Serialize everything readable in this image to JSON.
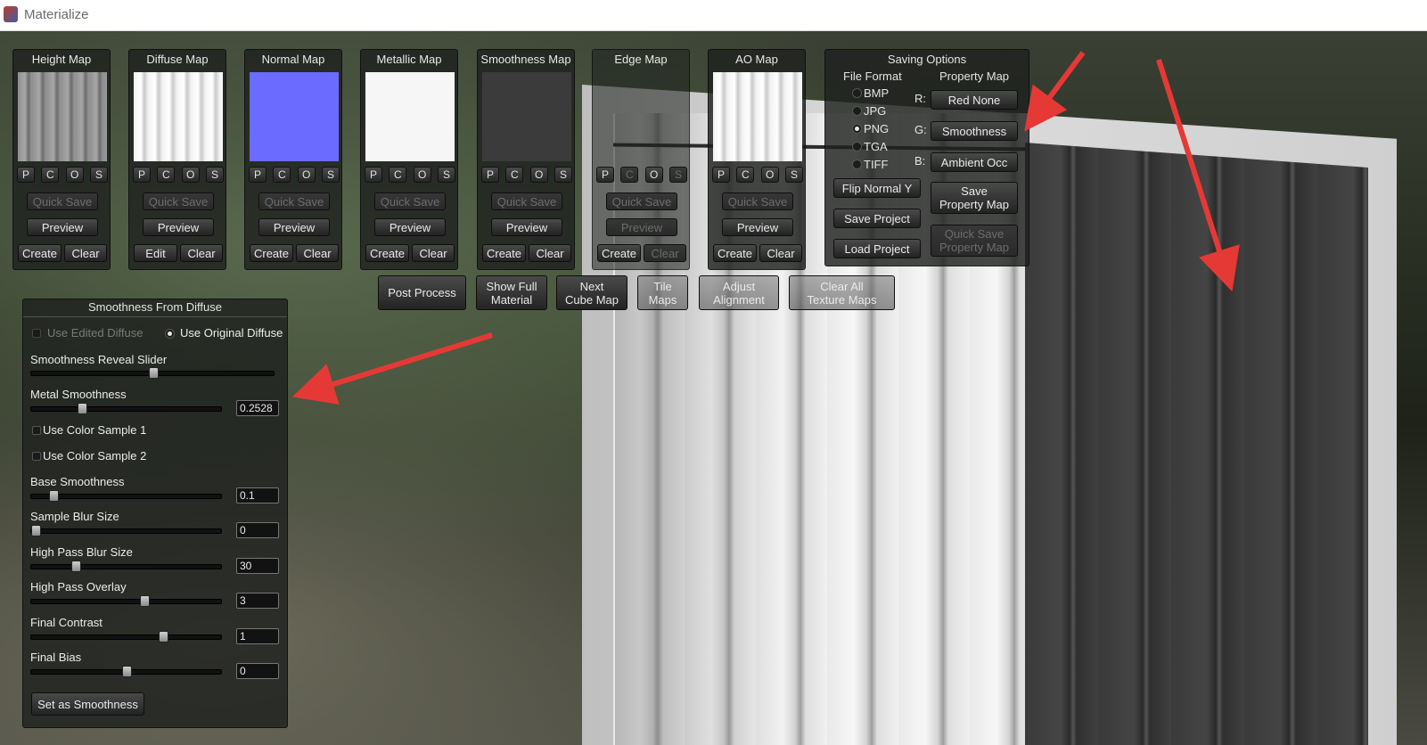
{
  "window": {
    "title": "Materialize"
  },
  "maps": [
    {
      "title": "Height Map",
      "thumb": "stripes-gray",
      "qs": "Quick Save",
      "preview": "Preview",
      "b1": "Create",
      "b2": "Clear"
    },
    {
      "title": "Diffuse Map",
      "thumb": "stripes-white",
      "qs": "Quick Save",
      "preview": "Preview",
      "b1": "Edit",
      "b2": "Clear"
    },
    {
      "title": "Normal Map",
      "thumb": "solid-blue",
      "qs": "Quick Save",
      "preview": "Preview",
      "b1": "Create",
      "b2": "Clear"
    },
    {
      "title": "Metallic Map",
      "thumb": "solid-white",
      "qs": "Quick Save",
      "preview": "Preview",
      "b1": "Create",
      "b2": "Clear"
    },
    {
      "title": "Smoothness Map",
      "thumb": "solid-dark",
      "qs": "Quick Save",
      "preview": "Preview",
      "b1": "Create",
      "b2": "Clear"
    },
    {
      "title": "Edge Map",
      "thumb": "none",
      "qs": "Quick Save",
      "preview": "Preview",
      "b1": "Create",
      "b2": "Clear"
    },
    {
      "title": "AO Map",
      "thumb": "stripes-white",
      "qs": "Quick Save",
      "preview": "Preview",
      "b1": "Create",
      "b2": "Clear"
    }
  ],
  "pcos": [
    "P",
    "C",
    "O",
    "S"
  ],
  "saving": {
    "title": "Saving Options",
    "file_format_label": "File Format",
    "property_map_label": "Property Map",
    "formats": [
      "BMP",
      "JPG",
      "PNG",
      "TGA",
      "TIFF"
    ],
    "selected_format": "PNG",
    "channels": [
      "R:",
      "G:",
      "B:"
    ],
    "channel_values": [
      "Red None",
      "Smoothness",
      "Ambient Occ"
    ],
    "flip_normal": "Flip Normal Y",
    "save_project": "Save Project",
    "load_project": "Load Project",
    "save_property_map": "Save\nProperty Map",
    "quick_save_property_map": "Quick Save\nProperty Map"
  },
  "toolbar": {
    "post_process": "Post Process",
    "show_full": "Show Full\nMaterial",
    "next_cube": "Next\nCube Map",
    "tile_maps": "Tile\nMaps",
    "adjust_alignment": "Adjust\nAlignment",
    "clear_all": "Clear All\nTexture Maps"
  },
  "smoothness": {
    "title": "Smoothness From Diffuse",
    "use_edited": "Use Edited Diffuse",
    "use_original": "Use Original Diffuse",
    "reveal_label": "Smoothness Reveal Slider",
    "reveal_level": 0.5,
    "metal_label": "Metal Smoothness",
    "metal_value": "0.2528",
    "metal_level": 0.2528,
    "color1": "Use Color Sample 1",
    "color2": "Use Color Sample 2",
    "base_label": "Base Smoothness",
    "base_value": "0.1",
    "base_level": 0.1,
    "blur_label": "Sample Blur Size",
    "blur_value": "0",
    "blur_level": 0.0,
    "hp_blur_label": "High Pass Blur Size",
    "hp_blur_value": "30",
    "hp_blur_level": 0.22,
    "hp_overlay_label": "High Pass Overlay",
    "hp_overlay_value": "3",
    "hp_overlay_level": 0.6,
    "contrast_label": "Final Contrast",
    "contrast_value": "1",
    "contrast_level": 0.7,
    "bias_label": "Final Bias",
    "bias_value": "0",
    "bias_level": 0.5,
    "set_button": "Set as Smoothness"
  },
  "colors": {
    "normal_blue": "#6b6bff",
    "arrow_red": "#e53935"
  }
}
